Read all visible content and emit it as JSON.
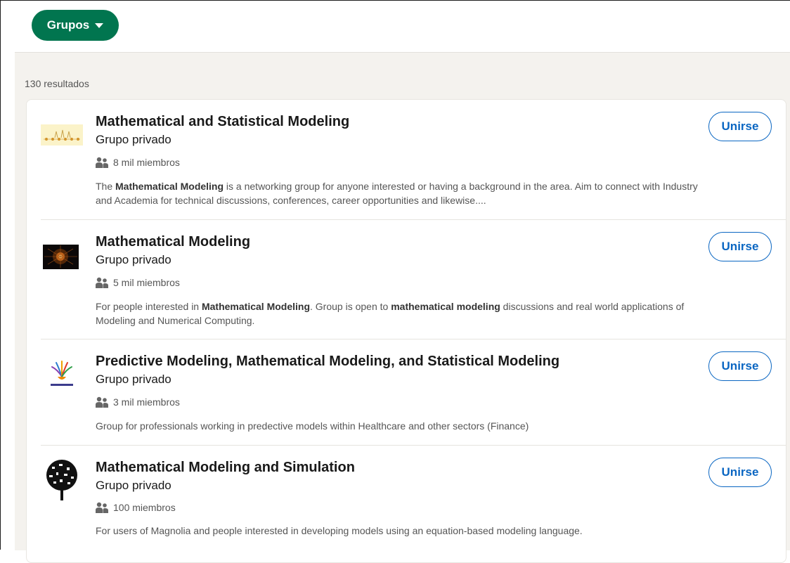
{
  "filter": {
    "label": "Grupos"
  },
  "results": {
    "count_label": "130 resultados"
  },
  "join_label": "Unirse",
  "colors": {
    "accent_green": "#01754f",
    "link_blue": "#0a66c2",
    "feed_bg": "#f4f2ee"
  },
  "icons": {
    "members": "people-icon",
    "dropdown": "caret-down-icon"
  },
  "groups": [
    {
      "title": "Mathematical and Statistical Modeling",
      "privacy": "Grupo privado",
      "members": "8 mil miembros",
      "desc": [
        {
          "t": "The "
        },
        {
          "t": "Mathematical Modeling",
          "b": true
        },
        {
          "t": " is a networking group for anyone interested or having a background in the area. Aim to connect with Industry and Academia for technical discussions, conferences, career opportunities and likewise...."
        }
      ]
    },
    {
      "title": "Mathematical Modeling",
      "privacy": "Grupo privado",
      "members": "5 mil miembros",
      "desc": [
        {
          "t": "For people interested in "
        },
        {
          "t": "Mathematical Modeling",
          "b": true
        },
        {
          "t": ". Group is open to "
        },
        {
          "t": "mathematical modeling",
          "b": true
        },
        {
          "t": " discussions and real world applications of Modeling and Numerical Computing."
        }
      ]
    },
    {
      "title": "Predictive Modeling, Mathematical Modeling, and Statistical Modeling",
      "privacy": "Grupo privado",
      "members": "3 mil miembros",
      "desc": [
        {
          "t": "Group for professionals working in predective models within Healthcare and other sectors (Finance)"
        }
      ]
    },
    {
      "title": "Mathematical Modeling and Simulation",
      "privacy": "Grupo privado",
      "members": "100 miembros",
      "desc": [
        {
          "t": "For users of Magnolia and people interested in developing models using an equation-based modeling language."
        }
      ]
    }
  ]
}
